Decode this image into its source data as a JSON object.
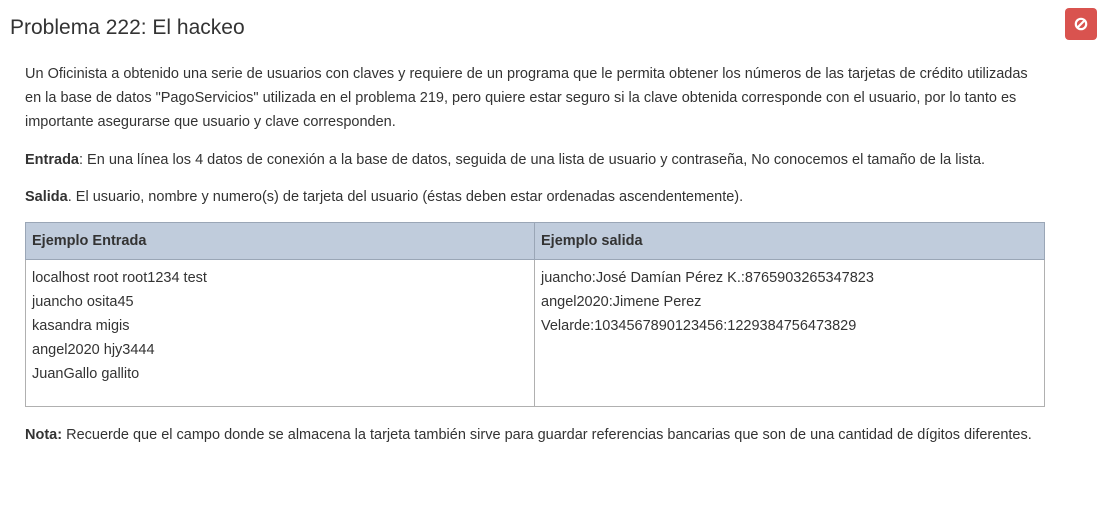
{
  "problem": {
    "title": "Problema 222: El hackeo",
    "close_icon": "ban-icon",
    "accent_color": "#d9534f"
  },
  "description": "Un Oficinista a obtenido una serie de usuarios con claves y requiere de un programa que le permita obtener los números de las tarjetas de crédito utilizadas en la base de datos \"PagoServicios\" utilizada en el problema 219, pero quiere estar seguro si la clave obtenida corresponde con el usuario, por lo tanto es  importante asegurarse que usuario y clave corresponden.",
  "entrada": {
    "label": "Entrada",
    "text": ": En una línea los 4 datos de conexión a la base de datos, seguida de una lista de usuario y contraseña, No conocemos el tamaño de la lista."
  },
  "salida": {
    "label": "Salida",
    "text": ". El usuario, nombre y numero(s) de tarjeta del usuario (éstas deben estar ordenadas ascendentemente)."
  },
  "table": {
    "header_input": "Ejemplo Entrada",
    "header_output": "Ejemplo salida",
    "input_lines": [
      "localhost root root1234 test",
      "juancho osita45",
      "kasandra migis",
      "angel2020 hjy3444",
      "JuanGallo gallito"
    ],
    "output_lines": [
      "juancho:José Damían Pérez K.:8765903265347823",
      "angel2020:Jimene Perez",
      "Velarde:1034567890123456:1229384756473829"
    ]
  },
  "nota": {
    "label": "Nota:",
    "text": " Recuerde que el campo donde se almacena la tarjeta también sirve para guardar referencias bancarias que son de una cantidad de dígitos diferentes."
  }
}
